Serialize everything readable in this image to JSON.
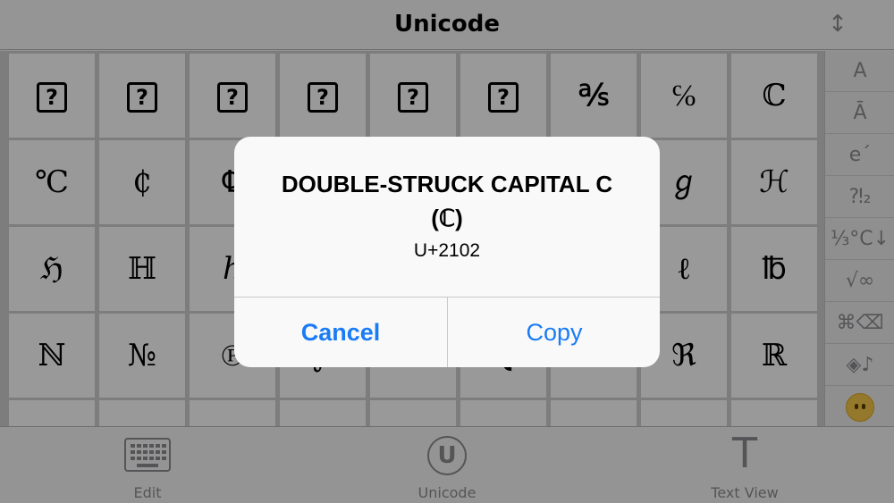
{
  "navbar": {
    "title": "Unicode",
    "sort_icon": "↕"
  },
  "grid": {
    "rows": [
      [
        "?",
        "?",
        "?",
        "?",
        "?",
        "?",
        "℁",
        "℅",
        "ℂ"
      ],
      [
        "℃",
        "₵",
        "℄",
        "",
        "",
        "",
        "",
        "ℊ",
        "ℋ"
      ],
      [
        "ℌ",
        "ℍ",
        "ℎ",
        "",
        "",
        "",
        "",
        "ℓ",
        "℔"
      ],
      [
        "ℕ",
        "№",
        "℗",
        "℘",
        "ℙ",
        "ℚ",
        "ℛ",
        "ℜ",
        "ℝ"
      ],
      [
        "",
        "",
        "",
        "",
        "",
        "",
        "",
        "",
        ""
      ]
    ],
    "box_columns_row0": [
      0,
      1,
      2,
      3,
      4,
      5
    ]
  },
  "index": {
    "items": [
      "A",
      "Ā",
      "e´",
      "⁈₂",
      "⅓°C↓",
      "√∞",
      "⌘⌫",
      "◈♪"
    ],
    "last_icon": "neutral-face-emoji"
  },
  "tabbar": {
    "tabs": [
      {
        "label": "Edit",
        "icon": "keyboard-icon"
      },
      {
        "label": "Unicode",
        "icon": "unicode-circle-icon",
        "glyph": "U"
      },
      {
        "label": "Text View",
        "icon": "text-icon",
        "glyph": "T"
      }
    ]
  },
  "alert": {
    "title_line1": "DOUBLE-STRUCK CAPITAL C",
    "title_line2": "(ℂ)",
    "message": "U+2102",
    "cancel_label": "Cancel",
    "copy_label": "Copy",
    "button_color": "#1a7cf5"
  }
}
